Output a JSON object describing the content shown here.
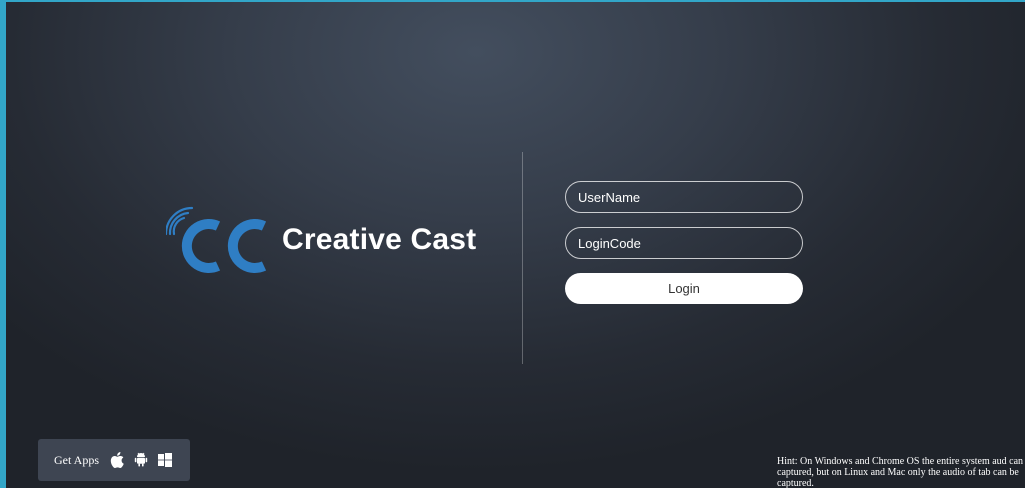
{
  "brand": {
    "name": "Creative Cast",
    "logo_icon": "cc-wifi-logo-icon",
    "accent_color": "#2f7ec4"
  },
  "login_form": {
    "username_placeholder": "UserName",
    "username_value": "",
    "logincode_placeholder": "LoginCode",
    "logincode_value": "",
    "login_label": "Login"
  },
  "get_apps": {
    "label": "Get Apps",
    "icons": [
      "apple-icon",
      "android-icon",
      "windows-icon"
    ]
  },
  "hint": {
    "text": "Hint: On Windows and Chrome OS the entire system aud can be captured, but on Linux and Mac only the audio of tab can be captured."
  },
  "colors": {
    "frame_border": "#32a6c8",
    "background": "#2c323c",
    "button_bg": "#ffffff"
  }
}
